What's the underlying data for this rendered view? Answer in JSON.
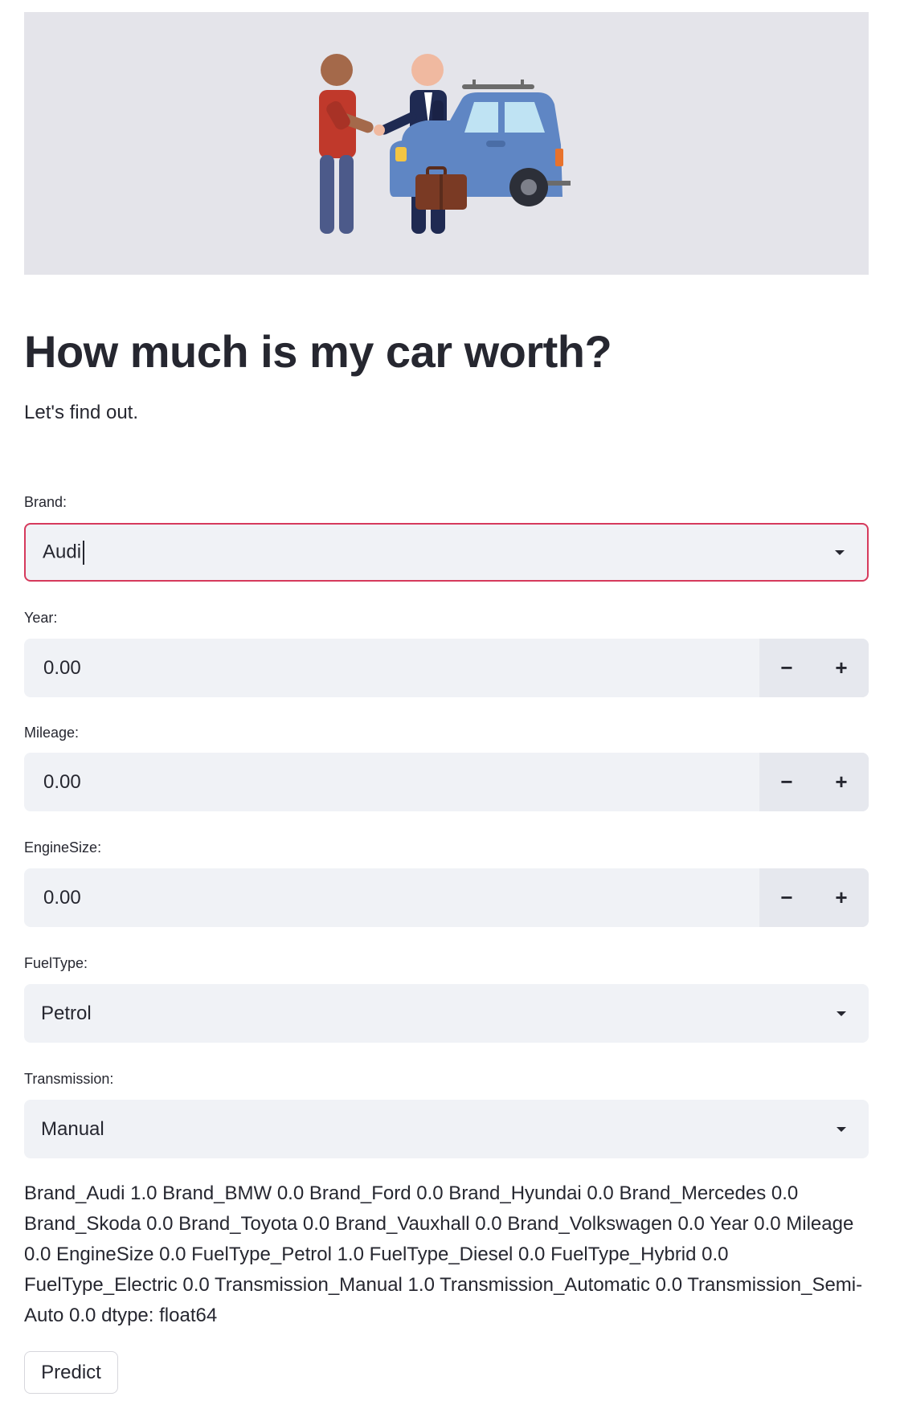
{
  "header": {
    "title": "How much is my car worth?",
    "subtitle": "Let's find out."
  },
  "hero": {
    "image": "car-sale-handshake-illustration"
  },
  "form": {
    "brand": {
      "label": "Brand:",
      "value": "Audi",
      "focused": true
    },
    "year": {
      "label": "Year:",
      "value": "0.00",
      "minus": "−",
      "plus": "+"
    },
    "mileage": {
      "label": "Mileage:",
      "value": "0.00",
      "minus": "−",
      "plus": "+"
    },
    "engine_size": {
      "label": "EngineSize:",
      "value": "0.00",
      "minus": "−",
      "plus": "+"
    },
    "fuel_type": {
      "label": "FuelType:",
      "value": "Petrol"
    },
    "transmission": {
      "label": "Transmission:",
      "value": "Manual"
    }
  },
  "series_output": "Brand_Audi 1.0 Brand_BMW 0.0 Brand_Ford 0.0 Brand_Hyundai 0.0 Brand_Mercedes 0.0 Brand_Skoda 0.0 Brand_Toyota 0.0 Brand_Vauxhall 0.0 Brand_Volkswagen 0.0 Year 0.0 Mileage 0.0 EngineSize 0.0 FuelType_Petrol 1.0 FuelType_Diesel 0.0 FuelType_Hybrid 0.0 FuelType_Electric 0.0 Transmission_Manual 1.0 Transmission_Automatic 0.0 Transmission_Semi-Auto 0.0 dtype: float64",
  "actions": {
    "predict_label": "Predict"
  },
  "colors": {
    "focus_border": "#d63a5c",
    "input_bg": "#f0f2f6",
    "hero_bg": "#e4e4ea",
    "text": "#262730"
  }
}
